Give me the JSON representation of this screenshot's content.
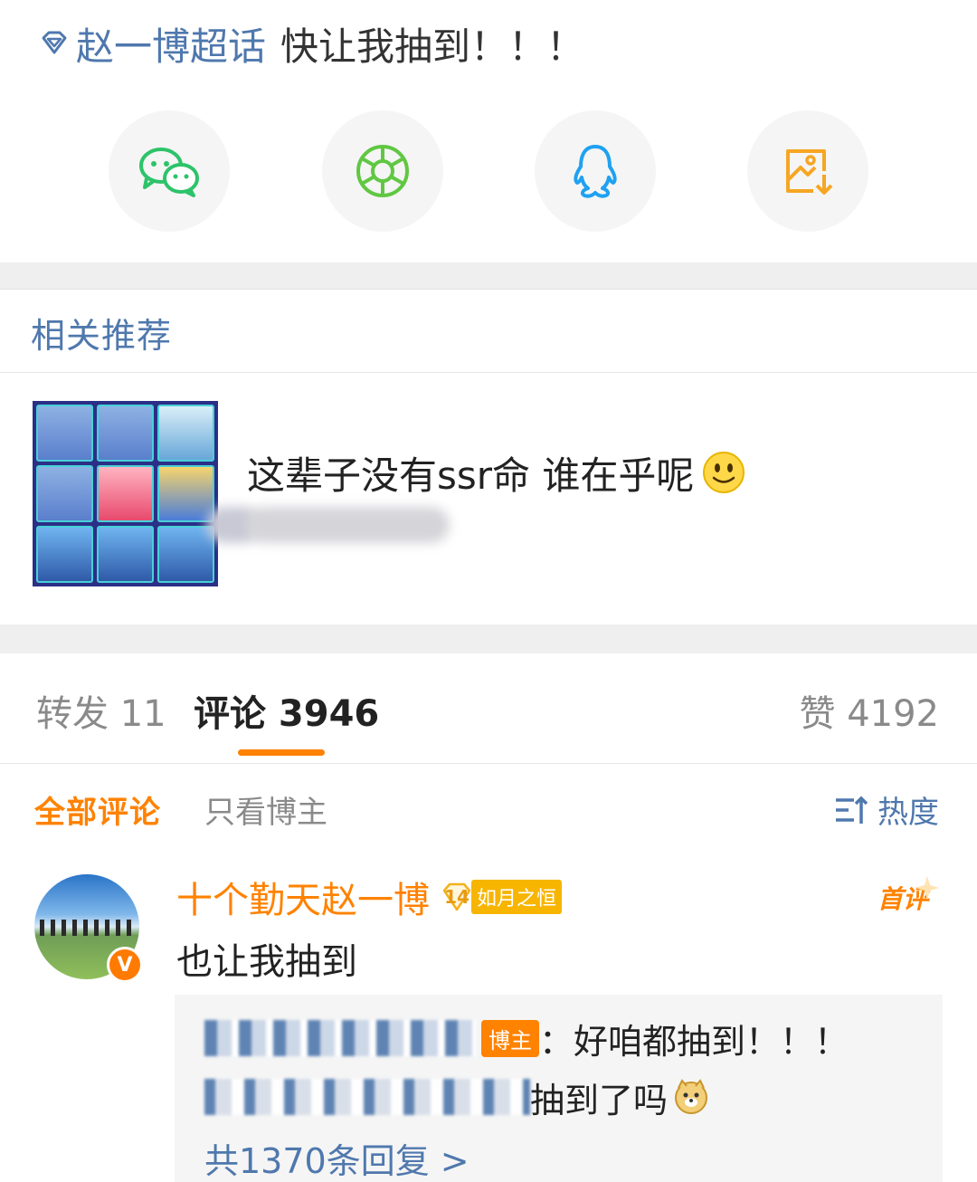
{
  "post": {
    "topic": "赵一博超话",
    "text": "快让我抽到！！！"
  },
  "share": {
    "items": [
      {
        "name": "wechat",
        "icon": "wechat-icon",
        "color": "#2dc36a"
      },
      {
        "name": "moments",
        "icon": "moments-icon",
        "color": "#60c742"
      },
      {
        "name": "qq",
        "icon": "qq-icon",
        "color": "#1fa1f1"
      },
      {
        "name": "save-image",
        "icon": "save-image-icon",
        "color": "#f6a623"
      }
    ]
  },
  "recommend": {
    "title": "相关推荐",
    "item": {
      "text": "这辈子没有ssr命 谁在乎呢",
      "emoji": "smile-emoji"
    }
  },
  "tabs": {
    "repost": "转发 11",
    "comments": "评论 3946",
    "likes": "赞 4192"
  },
  "filters": {
    "all": "全部评论",
    "blogger_only": "只看博主",
    "sort": "热度"
  },
  "comment": {
    "username": "十个勤天赵一博",
    "fan_level": "14",
    "fan_name": "如月之恒",
    "first_badge": "首评",
    "verified_mark": "V",
    "text": "也让我抽到",
    "replies": [
      {
        "author_tag": "博主",
        "text": "：好咱都抽到！！！"
      },
      {
        "text": "抽到了吗"
      }
    ],
    "total_replies": "共1370条回复 >"
  },
  "colors": {
    "accent": "#ff8200",
    "link": "#4f78ad",
    "background_gap": "#efefef",
    "reply_bg": "#f5f5f5"
  }
}
